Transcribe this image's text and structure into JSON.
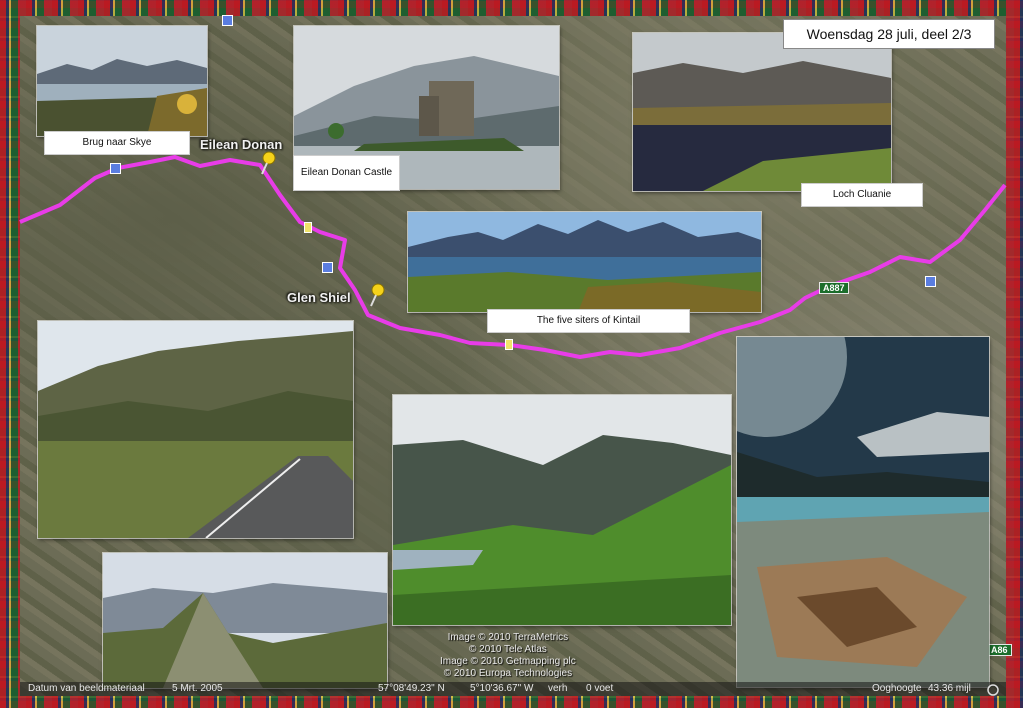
{
  "title": "Woensdag 28 juli, deel 2/3",
  "captions": {
    "brug": "Brug naar Skye",
    "eilean": "Eilean Donan Castle",
    "cluanie": "Loch Cluanie",
    "kintail": "The five siters of Kintail"
  },
  "map_labels": {
    "eilean_donan": "Eilean Donan",
    "glen_shiel": "Glen Shiel",
    "a887": "A887",
    "a86": "A86"
  },
  "copyright_lines": [
    "Image © 2010 TerraMetrics",
    "© 2010 Tele Atlas",
    "Image © 2010 Getmapping plc",
    "© 2010 Europa Technologies"
  ],
  "status": {
    "date_label": "Datum van beeldmateriaal",
    "date_value": "5 Mrt. 2005",
    "lat": "57°08'49.23\" N",
    "lon": "5°10'36.67\" W",
    "elev_label": "verh",
    "elev_value": "0 voet",
    "eye_label": "Ooghoogte",
    "eye_value": "43.36 mijl"
  },
  "colors": {
    "route": "#e83ce8",
    "pin": "#f5d21a"
  }
}
